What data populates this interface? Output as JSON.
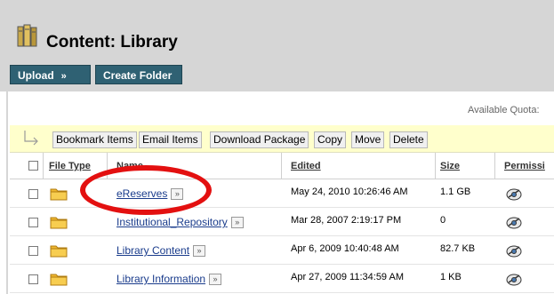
{
  "page": {
    "title": "Content: Library",
    "title_icon": "library-books-icon"
  },
  "toolbar": {
    "upload_label": "Upload",
    "upload_icon": "double-chevron-down-icon",
    "create_folder_label": "Create Folder"
  },
  "quota_label": "Available Quota:",
  "action_bar": {
    "arrow_icon": "bent-arrow-icon",
    "buttons": [
      "Bookmark Items",
      "Email Items",
      "Download Package",
      "Copy",
      "Move",
      "Delete"
    ]
  },
  "table": {
    "headers": {
      "file_type": "File Type",
      "name": "Name",
      "edited": "Edited",
      "size": "Size",
      "permissions": "Permissi"
    },
    "rows": [
      {
        "name": "eReserves",
        "edited": "May 24, 2010 10:26:46 AM",
        "size": "1.1 GB",
        "type_icon": "folder-icon",
        "perm_icon": "permissions-icon"
      },
      {
        "name": "Institutional_Repository",
        "edited": "Mar 28, 2007 2:19:17 PM",
        "size": "0",
        "type_icon": "folder-icon",
        "perm_icon": "permissions-icon"
      },
      {
        "name": "Library Content",
        "edited": "Apr 6, 2009 10:40:48 AM",
        "size": "82.7 KB",
        "type_icon": "folder-icon",
        "perm_icon": "permissions-icon"
      },
      {
        "name": "Library Information",
        "edited": "Apr 27, 2009 11:34:59 AM",
        "size": "1 KB",
        "type_icon": "folder-icon",
        "perm_icon": "permissions-icon"
      }
    ]
  },
  "annotation": {
    "highlight_color": "#e31010"
  },
  "colors": {
    "header_bg": "#d6d6d6",
    "button_bg": "#2f6173",
    "action_bar_bg": "#ffffcc",
    "link": "#1a3c8c"
  }
}
